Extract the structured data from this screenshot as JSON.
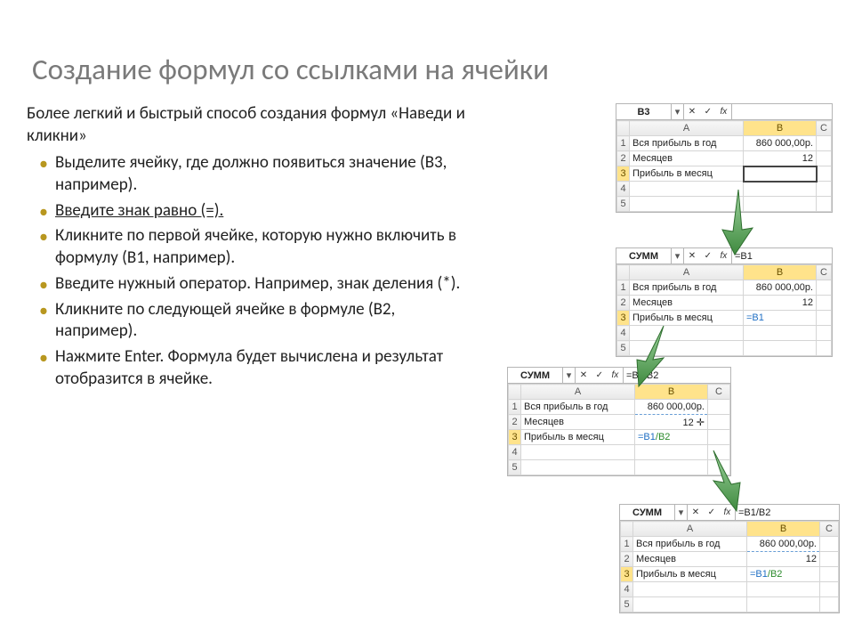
{
  "title": "Создание формул со ссылками на ячейки",
  "intro": "Более легкий и быстрый способ создания формул «Наведи и кликни»",
  "bullets": [
    "Выделите ячейку, где должно появиться значение (B3, например).",
    "Введите знак равно (=).",
    "Кликните по первой ячейке, которую нужно включить в формулу (B1, например).",
    "Введите нужный оператор. Например, знак деления (*).",
    "Кликните по следующей ячейке в формуле (B2, например).",
    "Нажмите Enter. Формула будет вычислена и результат отобразится в ячейке."
  ],
  "rows": {
    "r1": {
      "a": "Вся прибыль в год",
      "b": "860 000,00р."
    },
    "r2": {
      "a": "Месяцев",
      "b": "12"
    },
    "r3": {
      "a": "Прибыль в месяц"
    }
  },
  "fx": {
    "name1": "B3",
    "val1": "",
    "name2": "СУММ",
    "val2": "=B1",
    "name3": "СУММ",
    "val3": "=B1/B2",
    "name4": "СУММ",
    "val4": "=B1/B2"
  },
  "cells": {
    "b3_2": "=B1",
    "b3_3_b1": "=B1",
    "b3_3_b2": "/B2",
    "b3_4_b1": "=B1",
    "b3_4_b2": "/B2"
  },
  "col": {
    "A": "A",
    "B": "B",
    "C": "C"
  },
  "rn": {
    "1": "1",
    "2": "2",
    "3": "3",
    "4": "4",
    "5": "5"
  },
  "icons": {
    "x": "✕",
    "chk": "✓",
    "fx": "fx",
    "drop": "▾"
  }
}
